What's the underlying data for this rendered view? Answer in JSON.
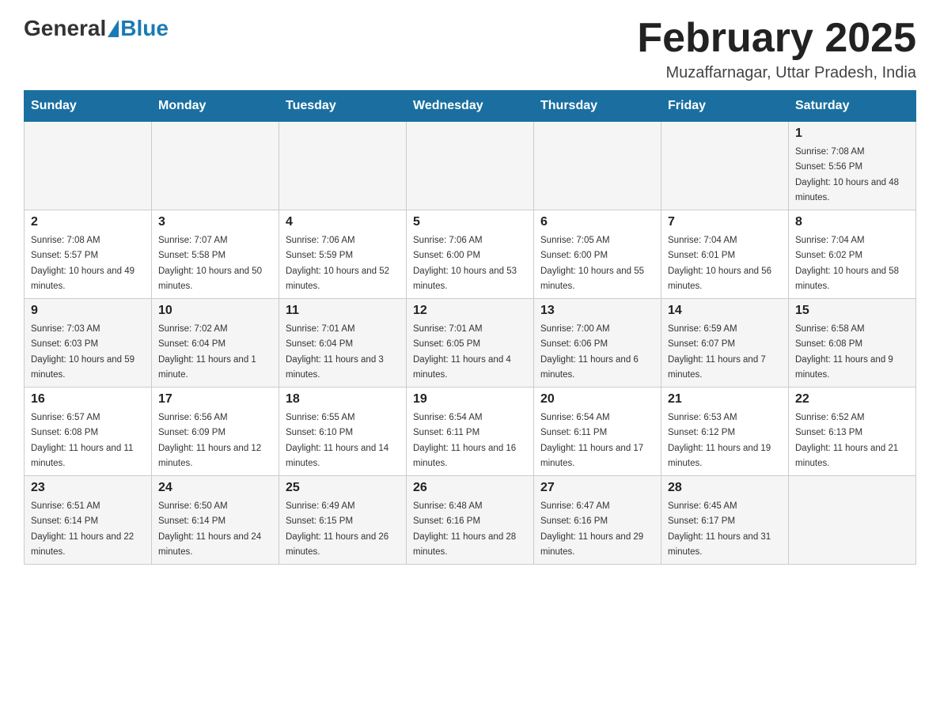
{
  "header": {
    "logo_general": "General",
    "logo_blue": "Blue",
    "month_title": "February 2025",
    "location": "Muzaffarnagar, Uttar Pradesh, India"
  },
  "days_of_week": [
    "Sunday",
    "Monday",
    "Tuesday",
    "Wednesday",
    "Thursday",
    "Friday",
    "Saturday"
  ],
  "weeks": [
    {
      "days": [
        {
          "date": "",
          "sunrise": "",
          "sunset": "",
          "daylight": ""
        },
        {
          "date": "",
          "sunrise": "",
          "sunset": "",
          "daylight": ""
        },
        {
          "date": "",
          "sunrise": "",
          "sunset": "",
          "daylight": ""
        },
        {
          "date": "",
          "sunrise": "",
          "sunset": "",
          "daylight": ""
        },
        {
          "date": "",
          "sunrise": "",
          "sunset": "",
          "daylight": ""
        },
        {
          "date": "",
          "sunrise": "",
          "sunset": "",
          "daylight": ""
        },
        {
          "date": "1",
          "sunrise": "Sunrise: 7:08 AM",
          "sunset": "Sunset: 5:56 PM",
          "daylight": "Daylight: 10 hours and 48 minutes."
        }
      ]
    },
    {
      "days": [
        {
          "date": "2",
          "sunrise": "Sunrise: 7:08 AM",
          "sunset": "Sunset: 5:57 PM",
          "daylight": "Daylight: 10 hours and 49 minutes."
        },
        {
          "date": "3",
          "sunrise": "Sunrise: 7:07 AM",
          "sunset": "Sunset: 5:58 PM",
          "daylight": "Daylight: 10 hours and 50 minutes."
        },
        {
          "date": "4",
          "sunrise": "Sunrise: 7:06 AM",
          "sunset": "Sunset: 5:59 PM",
          "daylight": "Daylight: 10 hours and 52 minutes."
        },
        {
          "date": "5",
          "sunrise": "Sunrise: 7:06 AM",
          "sunset": "Sunset: 6:00 PM",
          "daylight": "Daylight: 10 hours and 53 minutes."
        },
        {
          "date": "6",
          "sunrise": "Sunrise: 7:05 AM",
          "sunset": "Sunset: 6:00 PM",
          "daylight": "Daylight: 10 hours and 55 minutes."
        },
        {
          "date": "7",
          "sunrise": "Sunrise: 7:04 AM",
          "sunset": "Sunset: 6:01 PM",
          "daylight": "Daylight: 10 hours and 56 minutes."
        },
        {
          "date": "8",
          "sunrise": "Sunrise: 7:04 AM",
          "sunset": "Sunset: 6:02 PM",
          "daylight": "Daylight: 10 hours and 58 minutes."
        }
      ]
    },
    {
      "days": [
        {
          "date": "9",
          "sunrise": "Sunrise: 7:03 AM",
          "sunset": "Sunset: 6:03 PM",
          "daylight": "Daylight: 10 hours and 59 minutes."
        },
        {
          "date": "10",
          "sunrise": "Sunrise: 7:02 AM",
          "sunset": "Sunset: 6:04 PM",
          "daylight": "Daylight: 11 hours and 1 minute."
        },
        {
          "date": "11",
          "sunrise": "Sunrise: 7:01 AM",
          "sunset": "Sunset: 6:04 PM",
          "daylight": "Daylight: 11 hours and 3 minutes."
        },
        {
          "date": "12",
          "sunrise": "Sunrise: 7:01 AM",
          "sunset": "Sunset: 6:05 PM",
          "daylight": "Daylight: 11 hours and 4 minutes."
        },
        {
          "date": "13",
          "sunrise": "Sunrise: 7:00 AM",
          "sunset": "Sunset: 6:06 PM",
          "daylight": "Daylight: 11 hours and 6 minutes."
        },
        {
          "date": "14",
          "sunrise": "Sunrise: 6:59 AM",
          "sunset": "Sunset: 6:07 PM",
          "daylight": "Daylight: 11 hours and 7 minutes."
        },
        {
          "date": "15",
          "sunrise": "Sunrise: 6:58 AM",
          "sunset": "Sunset: 6:08 PM",
          "daylight": "Daylight: 11 hours and 9 minutes."
        }
      ]
    },
    {
      "days": [
        {
          "date": "16",
          "sunrise": "Sunrise: 6:57 AM",
          "sunset": "Sunset: 6:08 PM",
          "daylight": "Daylight: 11 hours and 11 minutes."
        },
        {
          "date": "17",
          "sunrise": "Sunrise: 6:56 AM",
          "sunset": "Sunset: 6:09 PM",
          "daylight": "Daylight: 11 hours and 12 minutes."
        },
        {
          "date": "18",
          "sunrise": "Sunrise: 6:55 AM",
          "sunset": "Sunset: 6:10 PM",
          "daylight": "Daylight: 11 hours and 14 minutes."
        },
        {
          "date": "19",
          "sunrise": "Sunrise: 6:54 AM",
          "sunset": "Sunset: 6:11 PM",
          "daylight": "Daylight: 11 hours and 16 minutes."
        },
        {
          "date": "20",
          "sunrise": "Sunrise: 6:54 AM",
          "sunset": "Sunset: 6:11 PM",
          "daylight": "Daylight: 11 hours and 17 minutes."
        },
        {
          "date": "21",
          "sunrise": "Sunrise: 6:53 AM",
          "sunset": "Sunset: 6:12 PM",
          "daylight": "Daylight: 11 hours and 19 minutes."
        },
        {
          "date": "22",
          "sunrise": "Sunrise: 6:52 AM",
          "sunset": "Sunset: 6:13 PM",
          "daylight": "Daylight: 11 hours and 21 minutes."
        }
      ]
    },
    {
      "days": [
        {
          "date": "23",
          "sunrise": "Sunrise: 6:51 AM",
          "sunset": "Sunset: 6:14 PM",
          "daylight": "Daylight: 11 hours and 22 minutes."
        },
        {
          "date": "24",
          "sunrise": "Sunrise: 6:50 AM",
          "sunset": "Sunset: 6:14 PM",
          "daylight": "Daylight: 11 hours and 24 minutes."
        },
        {
          "date": "25",
          "sunrise": "Sunrise: 6:49 AM",
          "sunset": "Sunset: 6:15 PM",
          "daylight": "Daylight: 11 hours and 26 minutes."
        },
        {
          "date": "26",
          "sunrise": "Sunrise: 6:48 AM",
          "sunset": "Sunset: 6:16 PM",
          "daylight": "Daylight: 11 hours and 28 minutes."
        },
        {
          "date": "27",
          "sunrise": "Sunrise: 6:47 AM",
          "sunset": "Sunset: 6:16 PM",
          "daylight": "Daylight: 11 hours and 29 minutes."
        },
        {
          "date": "28",
          "sunrise": "Sunrise: 6:45 AM",
          "sunset": "Sunset: 6:17 PM",
          "daylight": "Daylight: 11 hours and 31 minutes."
        },
        {
          "date": "",
          "sunrise": "",
          "sunset": "",
          "daylight": ""
        }
      ]
    }
  ]
}
